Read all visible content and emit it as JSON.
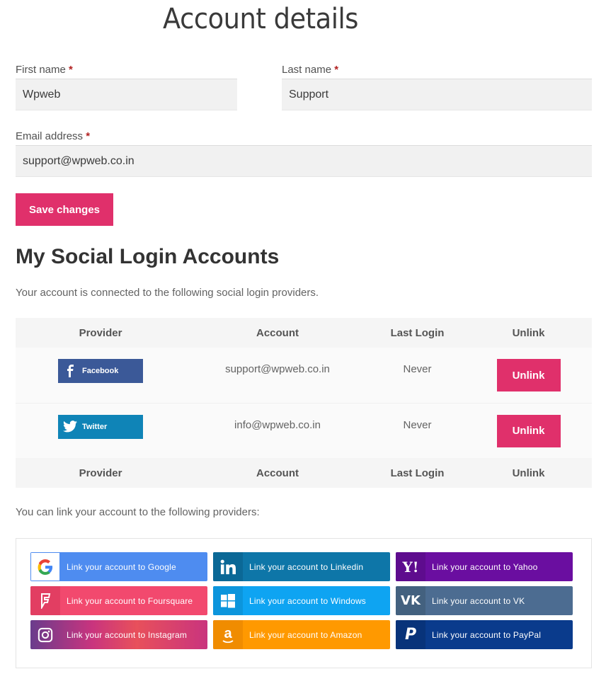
{
  "page_title": "Account details",
  "form": {
    "first_name_label": "First name",
    "last_name_label": "Last name",
    "email_label": "Email address",
    "required_mark": "*",
    "first_name_value": "Wpweb",
    "last_name_value": "Support",
    "email_value": "support@wpweb.co.in",
    "save_label": "Save changes"
  },
  "social": {
    "heading": "My Social Login Accounts",
    "intro": "Your account is connected to the following social login providers.",
    "columns": [
      "Provider",
      "Account",
      "Last Login",
      "Unlink"
    ],
    "rows": [
      {
        "provider": "Facebook",
        "account": "support@wpweb.co.in",
        "last_login": "Never",
        "action": "Unlink"
      },
      {
        "provider": "Twitter",
        "account": "info@wpweb.co.in",
        "last_login": "Never",
        "action": "Unlink"
      }
    ],
    "link_intro": "You can link your account to the following providers:",
    "link_buttons": [
      {
        "label": "Link your account to Google",
        "icon": "google-icon",
        "color": "#4e8cf0"
      },
      {
        "label": "Link your account to Linkedin",
        "icon": "linkedin-icon",
        "color": "#0e76a8"
      },
      {
        "label": "Link your account to Yahoo",
        "icon": "yahoo-icon",
        "color": "#6a0ea0"
      },
      {
        "label": "Link your account to Foursquare",
        "icon": "foursquare-icon",
        "color": "#f2496e"
      },
      {
        "label": "Link your account to Windows",
        "icon": "windows-icon",
        "color": "#0ea4f2"
      },
      {
        "label": "Link your account to VK",
        "icon": "vk-icon",
        "color": "#4c6c91"
      },
      {
        "label": "Link your account to Instagram",
        "icon": "instagram-icon",
        "color": "#c9347e"
      },
      {
        "label": "Link your account to Amazon",
        "icon": "amazon-icon",
        "color": "#ff9900"
      },
      {
        "label": "Link your account to PayPal",
        "icon": "paypal-icon",
        "color": "#0a3b8c"
      }
    ]
  },
  "colors": {
    "accent": "#e0306b",
    "field_bg": "#f1f1f1",
    "facebook": "#3b5998",
    "twitter": "#0f84b7"
  }
}
